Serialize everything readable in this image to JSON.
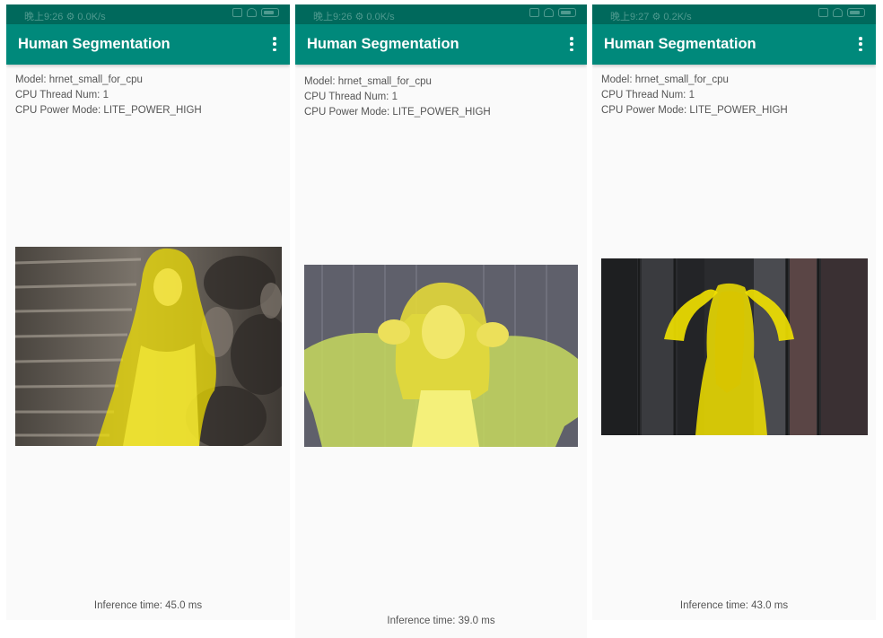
{
  "colors": {
    "status_bar": "#00695c",
    "app_bar": "#00897b",
    "background": "#fafafa",
    "mask": "#f2e200",
    "text": "#555555"
  },
  "screens": [
    {
      "status": {
        "time": "晚上9:26",
        "speed": "0.0K/s"
      },
      "app_title": "Human Segmentation",
      "menu_icon": "more-vert-icon",
      "model": "Model: hrnet_small_for_cpu",
      "threads": "CPU Thread Num: 1",
      "power": "CPU Power Mode: LITE_POWER_HIGH",
      "result_image": "segmented photo: woman with long hair standing beside stone steps, yellow mask over person",
      "inference": "Inference time: 45.0 ms"
    },
    {
      "status": {
        "time": "晚上9:26",
        "speed": "0.0K/s"
      },
      "app_title": "Human Segmentation",
      "menu_icon": "more-vert-icon",
      "model": "Model: hrnet_small_for_cpu",
      "threads": "CPU Thread Num: 1",
      "power": "CPU Power Mode: LITE_POWER_HIGH",
      "result_image": "segmented photo: woman making peace signs over eyes, yellow mask over person",
      "inference": "Inference time: 39.0 ms"
    },
    {
      "status": {
        "time": "晚上9:27",
        "speed": "0.2K/s"
      },
      "app_title": "Human Segmentation",
      "menu_icon": "more-vert-icon",
      "model": "Model: hrnet_small_for_cpu",
      "threads": "CPU Thread Num: 1",
      "power": "CPU Power Mode: LITE_POWER_HIGH",
      "result_image": "segmented photo: woman seen from behind holding her hair, yellow mask over person",
      "inference": "Inference time: 43.0 ms"
    }
  ]
}
